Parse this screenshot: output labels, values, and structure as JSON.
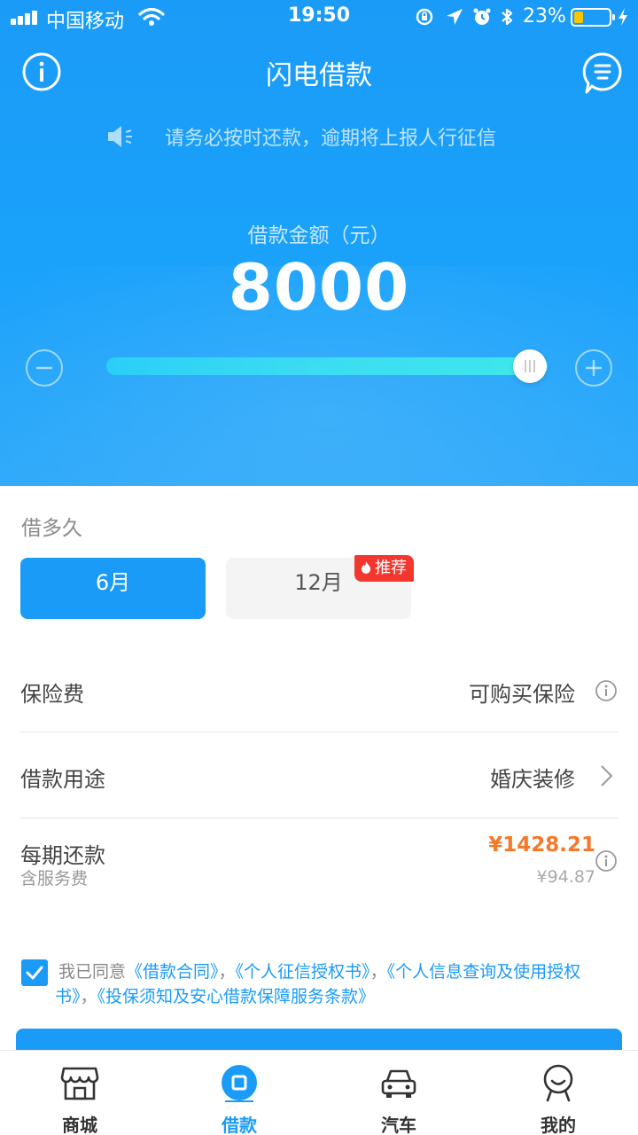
{
  "status_bar": {
    "carrier": "中国移动",
    "time": "19:50",
    "battery": "23%"
  },
  "header": {
    "title": "闪电借款"
  },
  "notice": {
    "text": "请务必按时还款，逾期将上报人行征信"
  },
  "amount": {
    "label": "借款金额（元）",
    "value": "8000",
    "slider_level_fraction": 0.96
  },
  "term": {
    "label": "借多久",
    "options": [
      {
        "label": "6月",
        "selected": true
      },
      {
        "label": "12月",
        "selected": false,
        "badge": "推荐"
      }
    ]
  },
  "insurance": {
    "label": "保险费",
    "value": "可购买保险"
  },
  "purpose": {
    "label": "借款用途",
    "value": "婚庆装修"
  },
  "repayment": {
    "label": "每期还款",
    "sub_label": "含服务费",
    "amount": "¥1428.21",
    "fee": "¥94.87"
  },
  "agreement": {
    "prefix": "我已同意",
    "links": [
      "《借款合同》",
      "《个人征信授权书》",
      "《个人信息查询及使用授权书》",
      "《投保须知及安心借款保障服务条款》"
    ],
    "separator": "，",
    "checked": true
  },
  "tabs": [
    {
      "label": "商城",
      "icon": "store-icon",
      "active": false
    },
    {
      "label": "借款",
      "icon": "loan-icon",
      "active": true
    },
    {
      "label": "汽车",
      "icon": "car-icon",
      "active": false
    },
    {
      "label": "我的",
      "icon": "profile-icon",
      "active": false
    }
  ],
  "colors": {
    "primary": "#1a9bf7",
    "accent": "#f5792a",
    "badge": "#f3372e"
  }
}
